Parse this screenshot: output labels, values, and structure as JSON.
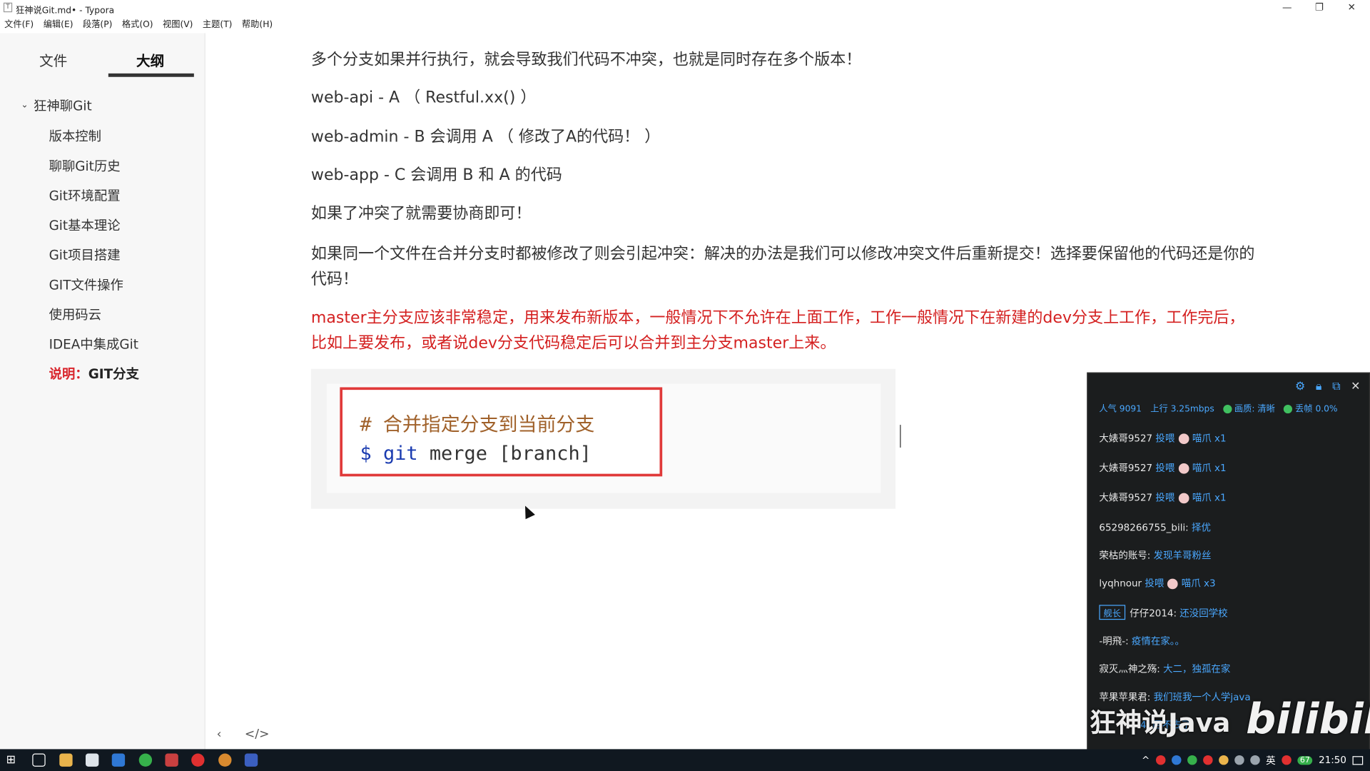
{
  "window": {
    "title": "狂神说Git.md• - Typora",
    "app_icon": "T",
    "controls": {
      "minimize": "—",
      "maximize": "❐",
      "close": "✕"
    }
  },
  "menu": [
    "文件(F)",
    "编辑(E)",
    "段落(P)",
    "格式(O)",
    "视图(V)",
    "主题(T)",
    "帮助(H)"
  ],
  "sidebar": {
    "tabs": [
      "文件",
      "大纲"
    ],
    "active_tab": "大纲",
    "root": "狂神聊Git",
    "items": [
      "版本控制",
      "聊聊Git历史",
      "Git环境配置",
      "Git基本理论",
      "Git项目搭建",
      "GIT文件操作",
      "使用码云",
      "IDEA中集成Git"
    ],
    "current_item_red": "说明：",
    "current_item_dark": "GIT分支",
    "footer_prev": "‹",
    "footer_source": "</>"
  },
  "content": {
    "p1": "多个分支如果并行执行，就会导致我们代码不冲突，也就是同时存在多个版本！",
    "p2": "web-api      - A  （ Restful.xx() ）",
    "p3": "web-admin - B 会调用 A （ 修改了A的代码！ ）",
    "p4": "web-app   - C 会调用 B 和 A 的代码",
    "p5": "如果了冲突了就需要协商即可！",
    "p6": "如果同一个文件在合并分支时都被修改了则会引起冲突：解决的办法是我们可以修改冲突文件后重新提交！选择要保留他的代码还是你的代码！",
    "p7": "master主分支应该非常稳定，用来发布新版本，一般情况下不允许在上面工作，工作一般情况下在新建的dev分支上工作，工作完后，比如上要发布，或者说dev分支代码稳定后可以合并到主分支master上来。",
    "code": {
      "comment": "#  合并指定分支到当前分支",
      "prompt": "$",
      "cmd": "git",
      "args": "merge [branch]"
    }
  },
  "overlay": {
    "icons": [
      "gear-icon",
      "lock-icon",
      "popout-icon",
      "close-icon"
    ],
    "stats": {
      "popularity": "人气  9091",
      "upload": "上行  3.25mbps",
      "quality": "画质: 清晰",
      "dropped": "丢帧 0.0%"
    },
    "messages": [
      {
        "user": "大婊哥9527",
        "text": "投喂",
        "gift": "喵爪 x1"
      },
      {
        "user": "大婊哥9527",
        "text": "投喂",
        "gift": "喵爪 x1"
      },
      {
        "user": "大婊哥9527",
        "text": "投喂",
        "gift": "喵爪 x1"
      },
      {
        "user": "65298266755_bili:",
        "text": "择优"
      },
      {
        "user": "荣枯的账号:",
        "text": "发现羊哥粉丝"
      },
      {
        "user": "lyqhnour",
        "text": "投喂",
        "gift": "喵爪 x3"
      },
      {
        "badge": "舰长",
        "user": "仔仔2014:",
        "text": "还没回学校"
      },
      {
        "user": "-明飛-:",
        "text": "疫情在家。。"
      },
      {
        "user": "寂灭灬神之殇:",
        "text": "大二，独孤在家"
      },
      {
        "user": "苹果苹果君:",
        "text": "我们班我一个人学java"
      },
      {
        "user": "",
        "text": "4:  回不去了"
      }
    ],
    "watermark": "狂神说Java",
    "logo": "bilibili"
  },
  "taskbar": {
    "lang": "英",
    "battery": "67",
    "time": "21:50",
    "colors": [
      "#ffffff",
      "#9aa4ad",
      "#e9b44c",
      "#dde4ea",
      "#2f78d4",
      "#36b04b",
      "#c94040",
      "#e03030",
      "#d88a2f",
      "#3b5fc0"
    ]
  }
}
